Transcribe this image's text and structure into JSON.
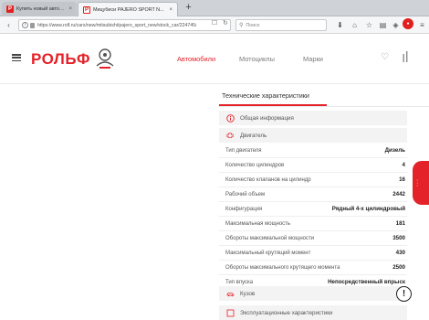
{
  "browser": {
    "tabs": [
      {
        "title": "Купить новый автомобиль 2...",
        "active": false
      },
      {
        "title": "Мицубиси PAJERO SPORT N...",
        "active": true
      }
    ],
    "new_tab": "+",
    "url": "https://www.rolf.ru/cars/new/mitsubishi/pajero_sport_new/stock_car/224745/",
    "search_placeholder": "Поиск"
  },
  "site": {
    "logo": "РОЛЬФ",
    "nav": [
      "Автомобили",
      "Мотоциклы",
      "Марки"
    ]
  },
  "content": {
    "section_tab": "Технические характеристики",
    "groups": {
      "info": "Общая информация",
      "engine": "Двигатель",
      "body": "Кузов",
      "ext": "Эксплуатационные характеристики"
    },
    "specs": [
      {
        "label": "Тип двигателя",
        "value": "Дизель"
      },
      {
        "label": "Количество цилиндров",
        "value": "4"
      },
      {
        "label": "Количество клапанов на цилиндр",
        "value": "16"
      },
      {
        "label": "Рабочий объем",
        "value": "2442"
      },
      {
        "label": "Конфигурация",
        "value": "Рядный 4-х цилиндровый"
      },
      {
        "label": "Максимальная мощность",
        "value": "181"
      },
      {
        "label": "Обороты максимальной мощности",
        "value": "3500"
      },
      {
        "label": "Максимальный крутящий момент",
        "value": "430"
      },
      {
        "label": "Обороты максимального крутящего момента",
        "value": "2500"
      },
      {
        "label": "Тип впуска",
        "value": "Непосредственный впрыск"
      }
    ]
  },
  "colors": {
    "accent": "#e42229"
  }
}
